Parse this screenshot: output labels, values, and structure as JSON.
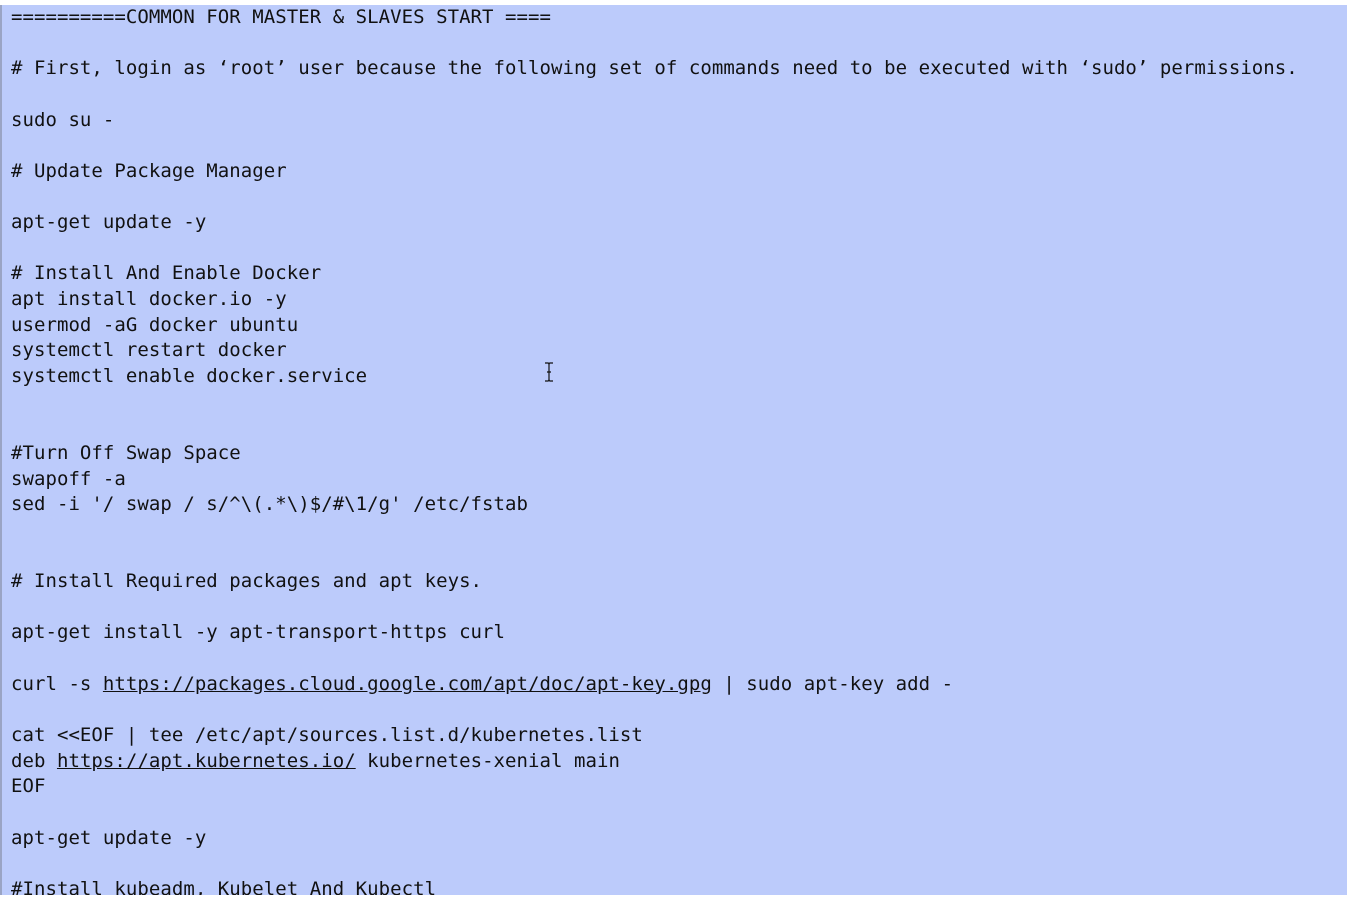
{
  "editor": {
    "lines": [
      {
        "text": "==========COMMON FOR MASTER & SLAVES START ===="
      },
      {
        "text": ""
      },
      {
        "text": "# First, login as ‘root’ user because the following set of commands need to be executed with ‘sudo’ permissions."
      },
      {
        "text": ""
      },
      {
        "text": "sudo su -"
      },
      {
        "text": ""
      },
      {
        "text": "# Update Package Manager"
      },
      {
        "text": ""
      },
      {
        "text": "apt-get update -y"
      },
      {
        "text": ""
      },
      {
        "text": "# Install And Enable Docker"
      },
      {
        "text": "apt install docker.io -y"
      },
      {
        "text": "usermod -aG docker ubuntu"
      },
      {
        "text": "systemctl restart docker"
      },
      {
        "text": "systemctl enable docker.service"
      },
      {
        "text": ""
      },
      {
        "text": ""
      },
      {
        "text": "#Turn Off Swap Space"
      },
      {
        "text": "swapoff -a"
      },
      {
        "text": "sed -i '/ swap / s/^\\(.*\\)$/#\\1/g' /etc/fstab"
      },
      {
        "text": ""
      },
      {
        "text": ""
      },
      {
        "text": "# Install Required packages and apt keys."
      },
      {
        "text": ""
      },
      {
        "text": "apt-get install -y apt-transport-https curl"
      },
      {
        "text": ""
      },
      {
        "pre": "curl -s ",
        "link": "https://packages.cloud.google.com/apt/doc/apt-key.gpg",
        "post": " | sudo apt-key add -"
      },
      {
        "text": ""
      },
      {
        "text": "cat <<EOF | tee /etc/apt/sources.list.d/kubernetes.list"
      },
      {
        "pre": "deb ",
        "link": "https://apt.kubernetes.io/",
        "post": " kubernetes-xenial main"
      },
      {
        "text": "EOF"
      },
      {
        "text": ""
      },
      {
        "text": "apt-get update -y"
      },
      {
        "text": ""
      },
      {
        "text": "#Install kubeadm, Kubelet And Kubectl"
      }
    ]
  }
}
